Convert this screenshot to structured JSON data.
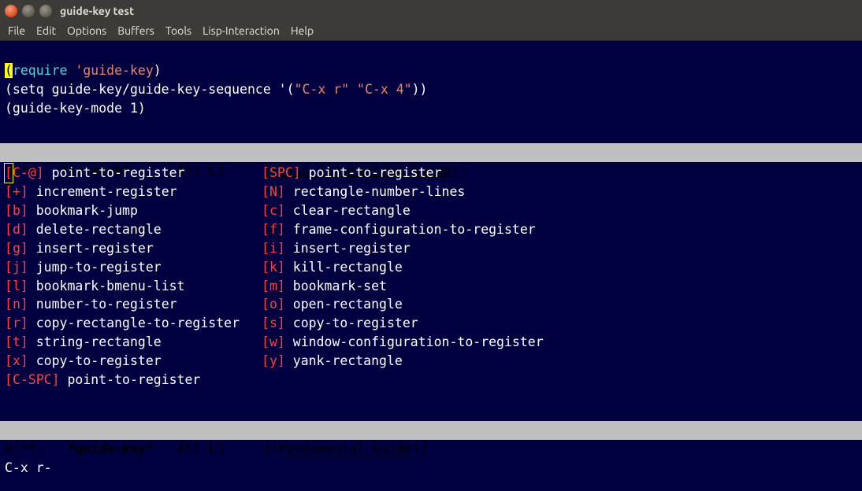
{
  "window": {
    "title": "guide-key test"
  },
  "menu": {
    "file": "File",
    "edit": "Edit",
    "options": "Options",
    "buffers": "Buffers",
    "tools": "Tools",
    "lisp": "Lisp-Interaction",
    "help": "Help"
  },
  "code": {
    "line1_open": "(",
    "line1_require": "require",
    "line1_space": " ",
    "line1_sym": "'guide-key",
    "line1_close": ")",
    "line2": "(setq guide-key/guide-key-sequence '(",
    "line2_s1": "\"C-x r\"",
    "line2_sp": " ",
    "line2_s2": "\"C-x 4\"",
    "line2_end": "))",
    "line3": "(guide-key-mode 1)"
  },
  "modeline1": {
    "status": "U:**-  ",
    "buffer": "*scratch*",
    "pos": "      All L1     ",
    "modes_open": "[(",
    "modes": "Lisp Interaction Guide",
    "modes_close": ")]"
  },
  "bindings": {
    "col1": [
      {
        "k": "C-@",
        "c": "point-to-register"
      },
      {
        "k": "+",
        "c": "increment-register"
      },
      {
        "k": "b",
        "c": "bookmark-jump"
      },
      {
        "k": "d",
        "c": "delete-rectangle"
      },
      {
        "k": "g",
        "c": "insert-register"
      },
      {
        "k": "j",
        "c": "jump-to-register"
      },
      {
        "k": "l",
        "c": "bookmark-bmenu-list"
      },
      {
        "k": "n",
        "c": "number-to-register"
      },
      {
        "k": "r",
        "c": "copy-rectangle-to-register"
      },
      {
        "k": "t",
        "c": "string-rectangle"
      },
      {
        "k": "x",
        "c": "copy-to-register"
      },
      {
        "k": "C-SPC",
        "c": "point-to-register"
      }
    ],
    "col2": [
      {
        "k": "SPC",
        "c": "point-to-register"
      },
      {
        "k": "N",
        "c": "rectangle-number-lines"
      },
      {
        "k": "c",
        "c": "clear-rectangle"
      },
      {
        "k": "f",
        "c": "frame-configuration-to-register"
      },
      {
        "k": "i",
        "c": "insert-register"
      },
      {
        "k": "k",
        "c": "kill-rectangle"
      },
      {
        "k": "m",
        "c": "bookmark-set"
      },
      {
        "k": "o",
        "c": "open-rectangle"
      },
      {
        "k": "s",
        "c": "copy-to-register"
      },
      {
        "k": "w",
        "c": "window-configuration-to-register"
      },
      {
        "k": "y",
        "c": "yank-rectangle"
      }
    ]
  },
  "modeline2": {
    "status": "U:**-   ",
    "buffer": "*guide-key*",
    "pos": "   All L1     ",
    "modes_open": "[(",
    "modes": "Fundamental Guide",
    "modes_close": ")]"
  },
  "minibuffer": {
    "text": "C-x r-"
  }
}
